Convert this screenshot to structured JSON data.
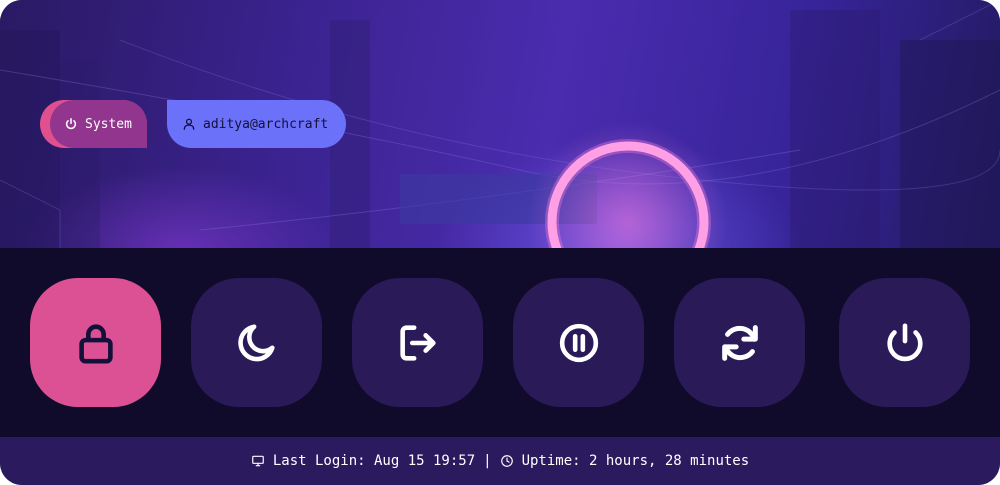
{
  "header": {
    "system_label": "System",
    "user_label": "aditya@archcraft",
    "system_icon": "power-icon",
    "user_icon": "user-icon"
  },
  "actions": [
    {
      "name": "lock",
      "icon": "lock-icon",
      "active": true
    },
    {
      "name": "suspend",
      "icon": "moon-icon",
      "active": false
    },
    {
      "name": "logout",
      "icon": "logout-icon",
      "active": false
    },
    {
      "name": "hibernate",
      "icon": "pause-icon",
      "active": false
    },
    {
      "name": "reboot",
      "icon": "refresh-icon",
      "active": false
    },
    {
      "name": "shutdown",
      "icon": "power-icon",
      "active": false
    }
  ],
  "footer": {
    "last_login": "Last Login: Aug 15 19:57",
    "separator": "|",
    "uptime": "Uptime: 2 hours, 28 minutes"
  },
  "colors": {
    "accent_pink": "#dc5193",
    "accent_blue": "#6b71f8",
    "button_bg": "#2a1a58",
    "panel_bg": "#100a2b",
    "footer_bg": "#2c1a5e"
  }
}
